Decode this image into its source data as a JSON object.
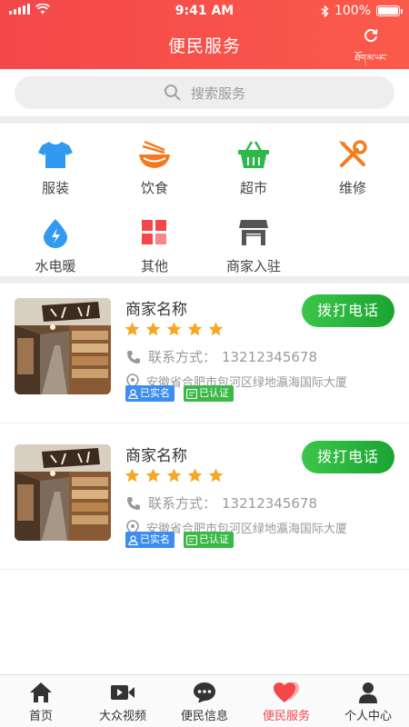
{
  "status_bar": {
    "time": "9:41 AM",
    "battery": "100%"
  },
  "header": {
    "title": "便民服务",
    "refresh_caption": "ཐོག་མ་ཡང་བསྐྱར།"
  },
  "search": {
    "placeholder": "搜索服务"
  },
  "categories": [
    {
      "label": "服装",
      "icon": "clothing-icon",
      "color": "#2f9af0"
    },
    {
      "label": "饮食",
      "icon": "food-bowl-icon",
      "color": "#f7791f"
    },
    {
      "label": "超市",
      "icon": "shopping-basket-icon",
      "color": "#2db84a"
    },
    {
      "label": "维修",
      "icon": "repair-tools-icon",
      "color": "#f57c1f"
    },
    {
      "label": "水电暖",
      "icon": "utilities-drop-icon",
      "color": "#2f9af0"
    },
    {
      "label": "其他",
      "icon": "grid-icon",
      "color": "#f4474a"
    },
    {
      "label": "商家入驻",
      "icon": "storefront-icon",
      "color": "#555555"
    }
  ],
  "merchants": [
    {
      "name": "商家名称",
      "rating": 5,
      "contact_label": "联系方式：",
      "phone": "13212345678",
      "address": "安徽省合肥市包河区绿地瀛海国际大厦",
      "tag_verified_name": "已实名",
      "tag_certified": "已认证",
      "call_label": "拨打电话"
    },
    {
      "name": "商家名称",
      "rating": 5,
      "contact_label": "联系方式：",
      "phone": "13212345678",
      "address": "安徽省合肥市包河区绿地瀛海国际大厦",
      "tag_verified_name": "已实名",
      "tag_certified": "已认证",
      "call_label": "拨打电话"
    }
  ],
  "tabs": [
    {
      "label": "首页",
      "icon": "home-icon",
      "active": false
    },
    {
      "label": "大众视频",
      "icon": "video-camera-icon",
      "active": false
    },
    {
      "label": "便民信息",
      "icon": "chat-bubble-icon",
      "active": false
    },
    {
      "label": "便民服务",
      "icon": "heart-icon",
      "active": true
    },
    {
      "label": "个人中心",
      "icon": "person-icon",
      "active": false
    }
  ],
  "colors": {
    "brand_red": "#f4474a",
    "call_green": "#2bb53f",
    "star": "#f5a623"
  }
}
